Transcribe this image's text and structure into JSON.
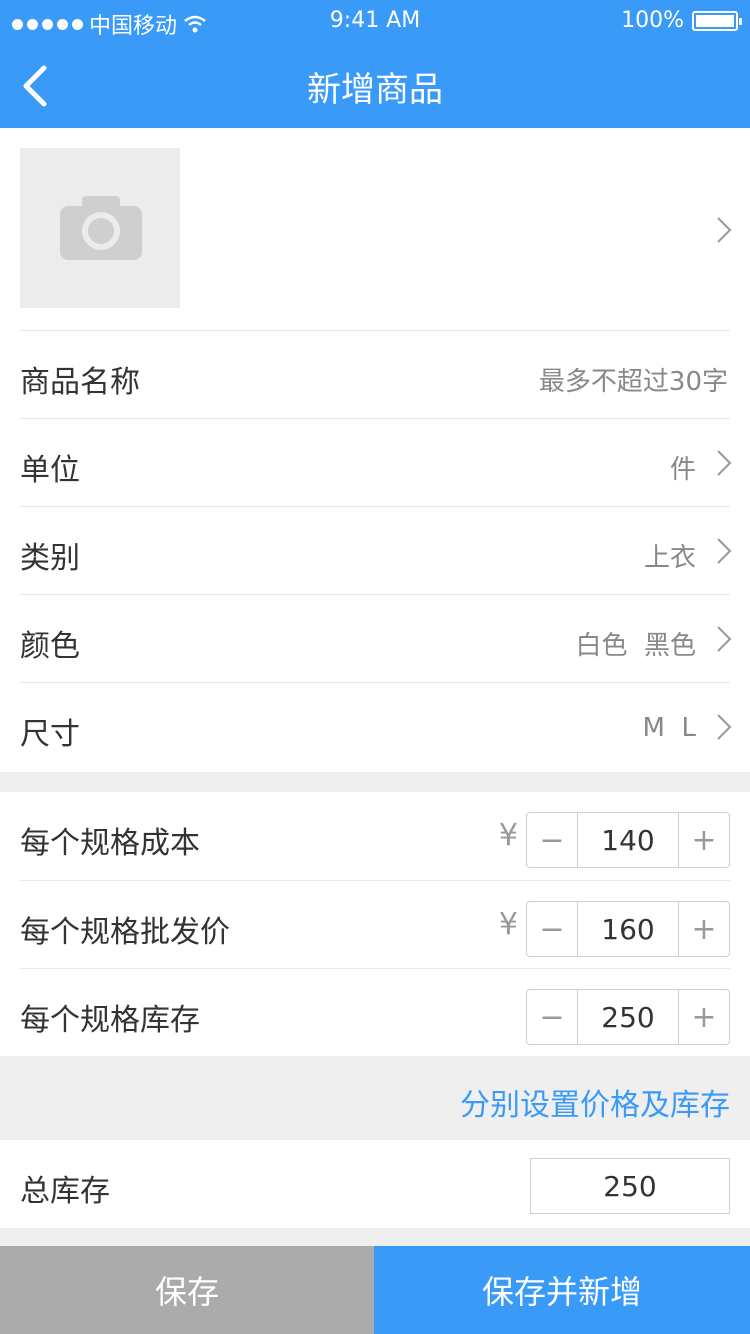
{
  "status_bar": {
    "carrier": "中国移动",
    "time": "9:41 AM",
    "battery": "100%"
  },
  "header": {
    "title": "新增商品"
  },
  "fields": {
    "name": {
      "label": "商品名称",
      "placeholder": "最多不超过30字"
    },
    "unit": {
      "label": "单位",
      "value": "件"
    },
    "category": {
      "label": "类别",
      "value": "上衣"
    },
    "color": {
      "label": "颜色",
      "value": "白色  黑色"
    },
    "size": {
      "label": "尺寸",
      "value": "M  L"
    }
  },
  "pricing": {
    "cost": {
      "label": "每个规格成本",
      "currency": "¥",
      "value": "140"
    },
    "wholesale": {
      "label": "每个规格批发价",
      "currency": "¥",
      "value": "160"
    },
    "stock": {
      "label": "每个规格库存",
      "value": "250"
    },
    "minus": "−",
    "plus": "+"
  },
  "separate_setting_link": "分别设置价格及库存",
  "total": {
    "label": "总库存",
    "value": "250"
  },
  "footer": {
    "save": "保存",
    "save_and_new": "保存并新增"
  },
  "colors": {
    "accent": "#3a9af8",
    "save_button_bg": "#ababab"
  }
}
